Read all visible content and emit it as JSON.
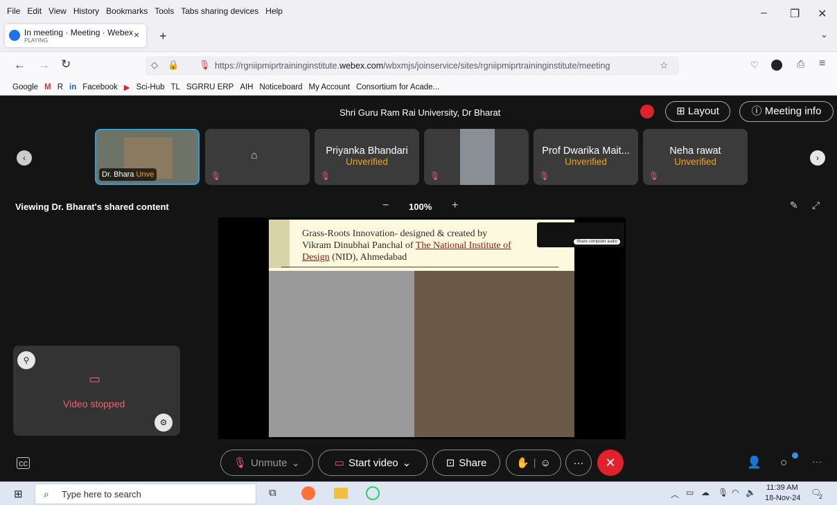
{
  "menu": [
    "File",
    "Edit",
    "View",
    "History",
    "Bookmarks",
    "Tools",
    "Tabs sharing devices",
    "Help"
  ],
  "tab": {
    "title": "In meeting · Meeting · Webex",
    "status": "PLAYING",
    "close": "×",
    "new": "+"
  },
  "url": {
    "prefix": "https://rgniipmiprtraininginstitute.",
    "domain": "webex.com",
    "path": "/wbxmjs/joinservice/sites/rgniipmiprtraininginstitute/meeting"
  },
  "bookmarks": [
    "Google",
    "R",
    "Facebook",
    "Sci-Hub",
    "TL",
    "SGRRU ERP",
    "AIH",
    "Noticeboard",
    "My Account",
    "Consortium for Acade..."
  ],
  "meeting": {
    "title": "Shri Guru Ram Rai University, Dr Bharat",
    "layout": "Layout",
    "info": "Meeting info",
    "viewing": "Viewing Dr. Bharat's shared content",
    "zoom": "100%",
    "minus": "−",
    "plus": "+"
  },
  "participants": [
    {
      "name": "Dr. Bhara",
      "tag": "Unve"
    },
    {
      "name": "",
      "tag": ""
    },
    {
      "name": "Priyanka Bhandari",
      "tag": "Unverified"
    },
    {
      "name": "",
      "tag": ""
    },
    {
      "name": "Prof Dwarika Mait...",
      "tag": "Unverified"
    },
    {
      "name": "Neha rawat",
      "tag": "Unverified"
    }
  ],
  "slide": {
    "line1": "Grass-Roots Innovation- designed & created by",
    "line2a": "Vikram Dinubhai Panchal of ",
    "link1": "The National Institute of",
    "link2": "Design",
    "line3": " (NID), Ahmedabad",
    "popup": "Share computer audio"
  },
  "self_view": {
    "status": "Video stopped"
  },
  "controls": {
    "unmute": "Unmute",
    "start_video": "Start video",
    "share": "Share",
    "close": "✕"
  },
  "taskbar": {
    "search": "Type here to search",
    "time": "11:39 AM",
    "date": "18-Nov-24",
    "notif": "2"
  },
  "colors": {
    "accent_red": "#e0222d",
    "unverified": "#f4a21d",
    "muted": "#f4606c"
  }
}
